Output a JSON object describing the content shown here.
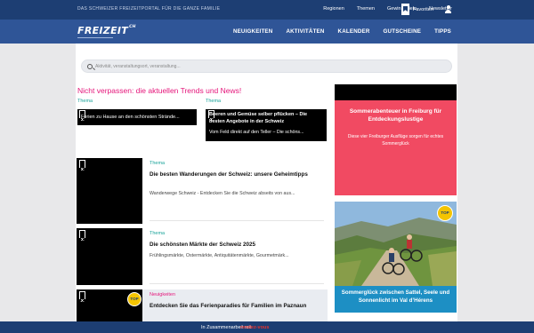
{
  "topbar": {
    "tagline": "DAS SCHWEIZER FREIZEITPORTAL FÜR DIE GANZE FAMILIE",
    "links": [
      "Regionen",
      "Themen",
      "Gewinnspiele",
      "Newsletter"
    ],
    "favorites": "Favoriten"
  },
  "nav": {
    "logo": "FREIZEIT",
    "logo_suffix": "CH",
    "items": [
      "NEUIGKEITEN",
      "AKTIVITÄTEN",
      "KALENDER",
      "GUTSCHEINE",
      "TIPPS"
    ]
  },
  "search": {
    "placeholder": "Aktivität, veranstaltungsort, veranstaltung..."
  },
  "section": {
    "heading": "Nicht verpassen: die aktuellen Trends und News!"
  },
  "featured": [
    {
      "tag": "Thema",
      "text": "Ferien zu Hause an den schönsten Strände..."
    },
    {
      "tag": "Thema",
      "title": "Beeren und Gemüse selber pflücken – Die besten Angebote in der Schweiz",
      "text": "Vom Feld direkt auf den Teller – Die schöns..."
    }
  ],
  "list": [
    {
      "tag": "Thema",
      "title": "Die besten Wanderungen der Schweiz: unsere Geheimtipps",
      "desc": "Wanderwege Schweiz - Entdecken Sie die Schweiz abseits von aus..."
    },
    {
      "tag": "Thema",
      "title": "Die schönsten Märkte der Schweiz 2025",
      "desc": "Frühlingsmärkte, Ostermärkte, Antiquitätenmärkte, Gourmetmärk..."
    },
    {
      "tag": "Neuigkeiten",
      "title": "Entdecken Sie das Ferienparadies für Familien im Paznaun",
      "badge": "TOP"
    }
  ],
  "ads": [
    {
      "title": "Sommerabenteuer in Freiburg für Entdeckungslustige",
      "subtitle": "Diese vier Freiburger Ausflüge sorgen für echtes Sommerglück"
    },
    {
      "title": "Sommerglück zwischen Sattel, Seele und Sonnenlicht im Val d’Hérens",
      "badge": "TOP"
    }
  ],
  "footer": {
    "label": "In Zusammenarbeit mit",
    "brand": "rendez-vous"
  },
  "colors": {
    "navy": "#1d3e73",
    "nav_blue": "#2f5597",
    "accent_pink": "#e5157a",
    "teal": "#19a39a",
    "ad_red": "#f14a62",
    "ad_blue": "#1d8fc4"
  }
}
